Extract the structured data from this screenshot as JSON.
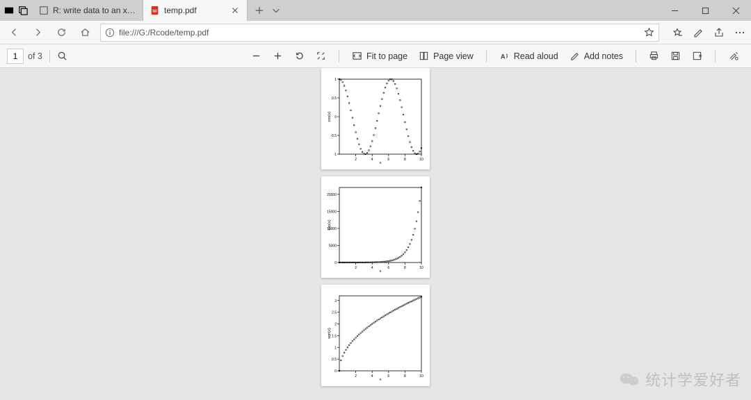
{
  "tabs": {
    "background": {
      "title": "R: write data to an xlsx file"
    },
    "active": {
      "title": "temp.pdf"
    }
  },
  "address": {
    "url": "file:///G:/Rcode/temp.pdf"
  },
  "pdfbar": {
    "page_current": "1",
    "page_of": "of 3",
    "fit": "Fit to page",
    "pageview": "Page view",
    "readaloud": "Read aloud",
    "addnotes": "Add notes"
  },
  "watermark": {
    "text": "统计学爱好者"
  },
  "chart_data": [
    {
      "type": "scatter",
      "title": "",
      "xlabel": "x",
      "ylabel": "cos(x)",
      "xlim": [
        0,
        10
      ],
      "ylim": [
        -1,
        1
      ],
      "xticks": [
        2,
        4,
        6,
        8,
        10
      ],
      "yticks": [
        -1.0,
        -0.5,
        0.0,
        0.5,
        1.0
      ],
      "x": [
        0,
        0.2,
        0.4,
        0.6,
        0.8,
        1,
        1.2,
        1.4,
        1.6,
        1.8,
        2,
        2.2,
        2.4,
        2.6,
        2.8,
        3,
        3.2,
        3.4,
        3.6,
        3.8,
        4,
        4.2,
        4.4,
        4.6,
        4.8,
        5,
        5.2,
        5.4,
        5.6,
        5.8,
        6,
        6.2,
        6.4,
        6.6,
        6.8,
        7,
        7.2,
        7.4,
        7.6,
        7.8,
        8,
        8.2,
        8.4,
        8.6,
        8.8,
        9,
        9.2,
        9.4,
        9.6,
        9.8,
        10
      ],
      "values": [
        1,
        0.98,
        0.921,
        0.825,
        0.697,
        0.54,
        0.362,
        0.17,
        -0.029,
        -0.227,
        -0.416,
        -0.589,
        -0.737,
        -0.857,
        -0.942,
        -0.99,
        -0.998,
        -0.967,
        -0.897,
        -0.79,
        -0.654,
        -0.49,
        -0.307,
        -0.112,
        0.087,
        0.284,
        0.469,
        0.635,
        0.776,
        0.886,
        0.96,
        0.996,
        0.993,
        0.95,
        0.869,
        0.754,
        0.608,
        0.439,
        0.252,
        0.054,
        -0.146,
        -0.339,
        -0.519,
        -0.679,
        -0.811,
        -0.911,
        -0.975,
        -0.999,
        -0.985,
        -0.93,
        -0.839
      ]
    },
    {
      "type": "scatter",
      "title": "",
      "xlabel": "x",
      "ylabel": "exp(x)",
      "xlim": [
        0,
        10
      ],
      "ylim": [
        0,
        22000
      ],
      "xticks": [
        2,
        4,
        6,
        8,
        10
      ],
      "yticks": [
        0,
        5000,
        10000,
        15000,
        20000
      ],
      "x": [
        0,
        0.2,
        0.4,
        0.6,
        0.8,
        1,
        1.2,
        1.4,
        1.6,
        1.8,
        2,
        2.2,
        2.4,
        2.6,
        2.8,
        3,
        3.2,
        3.4,
        3.6,
        3.8,
        4,
        4.2,
        4.4,
        4.6,
        4.8,
        5,
        5.2,
        5.4,
        5.6,
        5.8,
        6,
        6.2,
        6.4,
        6.6,
        6.8,
        7,
        7.2,
        7.4,
        7.6,
        7.8,
        8,
        8.2,
        8.4,
        8.6,
        8.8,
        9,
        9.2,
        9.4,
        9.6,
        9.8,
        10
      ],
      "values": [
        1,
        1.22,
        1.49,
        1.82,
        2.23,
        2.72,
        3.32,
        4.06,
        4.95,
        6.05,
        7.39,
        9.03,
        11.02,
        13.46,
        16.44,
        20.09,
        24.53,
        29.96,
        36.6,
        44.7,
        54.6,
        66.69,
        81.45,
        99.48,
        121.51,
        148.41,
        181.27,
        221.41,
        270.43,
        330.3,
        403.43,
        492.75,
        601.85,
        735.1,
        897.85,
        1096.63,
        1339.43,
        1635.98,
        1998.2,
        2440.6,
        2981,
        3641,
        4447,
        5432,
        6634,
        8103,
        9897,
        12088,
        14765,
        18034,
        22026
      ]
    },
    {
      "type": "scatter",
      "title": "",
      "xlabel": "x",
      "ylabel": "sqrt(x)",
      "xlim": [
        0,
        10
      ],
      "ylim": [
        0,
        3.2
      ],
      "xticks": [
        2,
        4,
        6,
        8,
        10
      ],
      "yticks": [
        0,
        0.5,
        1.0,
        1.5,
        2.0,
        2.5,
        3.0
      ],
      "x": [
        0,
        0.2,
        0.4,
        0.6,
        0.8,
        1,
        1.2,
        1.4,
        1.6,
        1.8,
        2,
        2.2,
        2.4,
        2.6,
        2.8,
        3,
        3.2,
        3.4,
        3.6,
        3.8,
        4,
        4.2,
        4.4,
        4.6,
        4.8,
        5,
        5.2,
        5.4,
        5.6,
        5.8,
        6,
        6.2,
        6.4,
        6.6,
        6.8,
        7,
        7.2,
        7.4,
        7.6,
        7.8,
        8,
        8.2,
        8.4,
        8.6,
        8.8,
        9,
        9.2,
        9.4,
        9.6,
        9.8,
        10
      ],
      "values": [
        0,
        0.447,
        0.632,
        0.775,
        0.894,
        1,
        1.095,
        1.183,
        1.265,
        1.342,
        1.414,
        1.483,
        1.549,
        1.612,
        1.673,
        1.732,
        1.789,
        1.844,
        1.897,
        1.949,
        2,
        2.049,
        2.098,
        2.145,
        2.191,
        2.236,
        2.28,
        2.324,
        2.366,
        2.408,
        2.449,
        2.49,
        2.53,
        2.569,
        2.608,
        2.646,
        2.683,
        2.72,
        2.757,
        2.793,
        2.828,
        2.864,
        2.898,
        2.933,
        2.966,
        3,
        3.033,
        3.066,
        3.098,
        3.13,
        3.162
      ]
    }
  ]
}
